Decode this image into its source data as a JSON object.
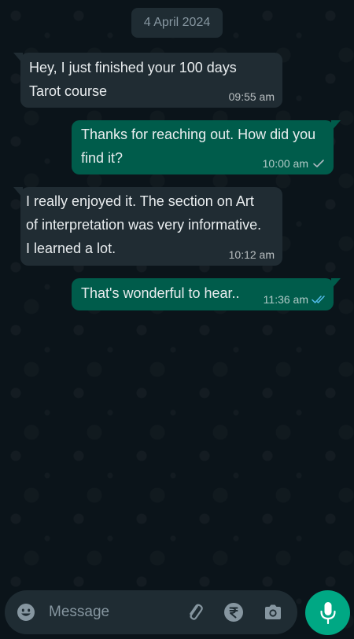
{
  "chat": {
    "date": "4 April 2024",
    "messages": [
      {
        "direction": "in",
        "text": "Hey, I just finished your 100 days\nTarot course",
        "time": "09:55 am"
      },
      {
        "direction": "out",
        "text": "Thanks for reaching out. How did you\nfind it?",
        "time": "10:00 am",
        "status": "sent"
      },
      {
        "direction": "in",
        "text": "I really enjoyed it. The section on Art\nof interpretation was very informative.\nI learned a lot.",
        "time": "10:12 am"
      },
      {
        "direction": "out",
        "text": "That's wonderful to hear..",
        "time": "11:36 am",
        "status": "read"
      }
    ]
  },
  "composer": {
    "placeholder": "Message",
    "icons": [
      "emoji-icon",
      "paperclip-icon",
      "rupee-icon",
      "camera-icon",
      "microphone-icon"
    ]
  },
  "colors": {
    "background": "#0b141a",
    "incoming_bubble": "#202c33",
    "outgoing_bubble": "#005c4b",
    "accent": "#00a884",
    "read_tick": "#53bdeb"
  }
}
